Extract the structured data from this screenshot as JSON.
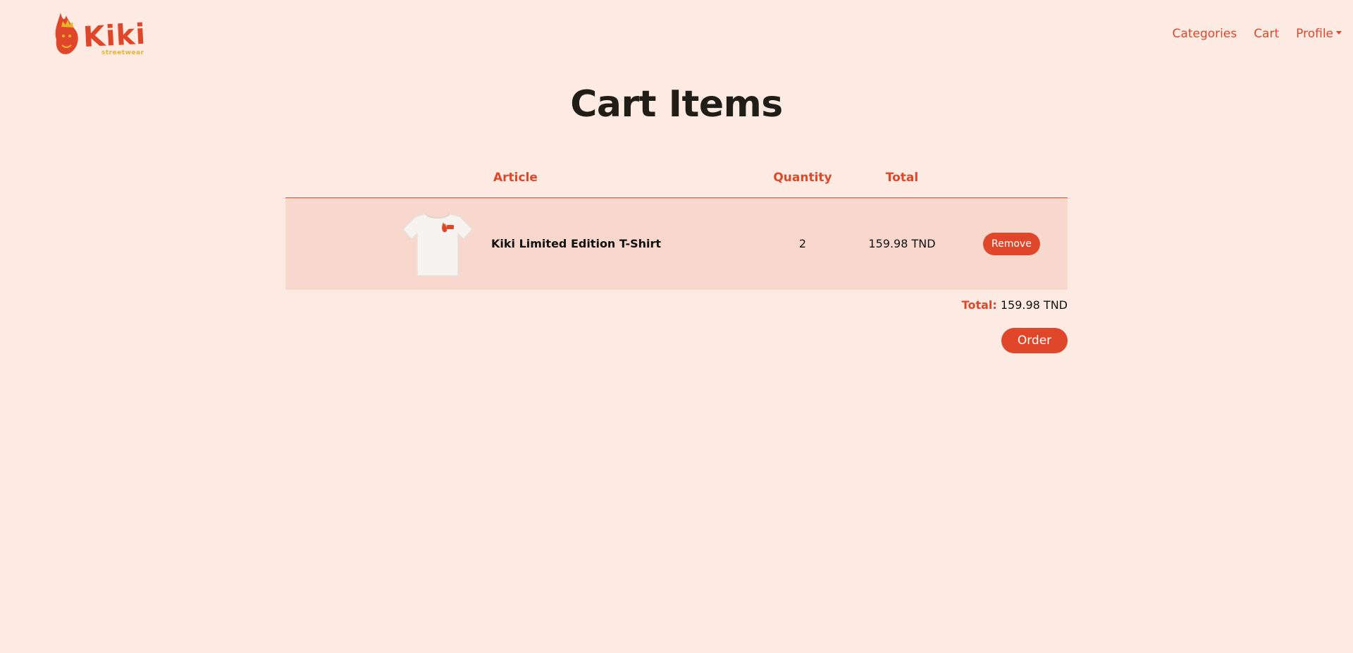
{
  "brand": {
    "name": "Kiki",
    "subtitle": "streetwear"
  },
  "nav": {
    "links": [
      "Categories",
      "Cart",
      "Profile"
    ]
  },
  "page": {
    "title": "Cart Items"
  },
  "table": {
    "headers": {
      "article": "Article",
      "quantity": "Quantity",
      "total": "Total"
    },
    "rows": [
      {
        "image": "tshirt-image",
        "name": "Kiki Limited Edition T-Shirt",
        "quantity": "2",
        "total": "159.98 TND",
        "action": "Remove"
      }
    ]
  },
  "summary": {
    "label": "Total:",
    "value": "159.98 TND"
  },
  "actions": {
    "order": "Order"
  },
  "colors": {
    "background": "#fdebe3",
    "accent": "#e0472a",
    "row_background": "#f8d8cd",
    "title": "#1f1d15",
    "logo_yellow": "#e6b528"
  }
}
